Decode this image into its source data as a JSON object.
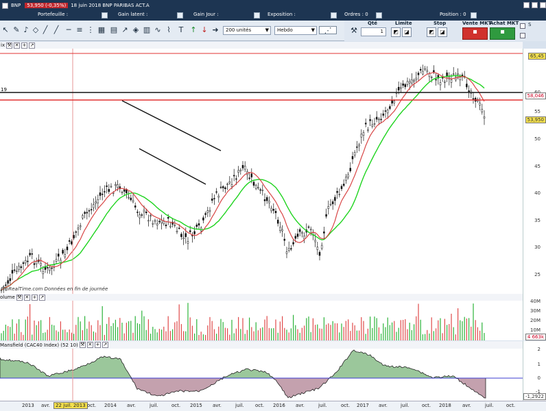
{
  "instrument": {
    "name": "BNP",
    "price_change": "53,950 (-0,35%)",
    "date_desc": "18 juin 2018 BNP PARIBAS ACT.A"
  },
  "header": {
    "portefeuille": "Portefeuille :",
    "gain_latent": "Gain latent :",
    "gain_jour": "Gain Jour :",
    "exposition": "Exposition :",
    "ordres": "Ordres : 0",
    "position": "Position : 0"
  },
  "toolbar": {
    "quantity": "200 unités",
    "period": "Hebdo"
  },
  "order": {
    "qte_label": "Qté",
    "qte_value": "1",
    "limite_label": "Limite",
    "stop_label": "Stop",
    "vente_label": "Vente MKT",
    "achat_label": "Achat MKT",
    "s_label": "S"
  },
  "price_panel": {
    "title": "ix",
    "axis_labels": [
      "65,45",
      "60",
      "58,046",
      "55",
      "53,950",
      "50",
      "45",
      "40",
      "35",
      "30",
      "25"
    ],
    "level_label": "19",
    "watermark": "ProRealTime.com  Données en fin de journée"
  },
  "volume_panel": {
    "title": "olume",
    "axis_labels": [
      "40M",
      "30M",
      "20M",
      "10M",
      "4 663k"
    ]
  },
  "mansfield_panel": {
    "title": "Mansfield (CAC40 Index) (52 10)",
    "axis_labels": [
      "2",
      "1",
      "0",
      "-1",
      "-1,2922"
    ]
  },
  "x_axis": {
    "labels": [
      "2013",
      "avr.",
      "22 juil. 2013",
      "oct.",
      "2014",
      "avr.",
      "juil.",
      "oct.",
      "2015",
      "avr.",
      "juil.",
      "oct.",
      "2016",
      "avr.",
      "juil.",
      "oct.",
      "2017",
      "avr.",
      "juil.",
      "oct.",
      "2018",
      "avr.",
      "juil.",
      "oct."
    ]
  },
  "colors": {
    "accent": "#1d3552",
    "sell": "#d0312d",
    "buy": "#2f9a3f",
    "ma_short": "#d84545",
    "ma_long": "#1fd41f"
  }
}
